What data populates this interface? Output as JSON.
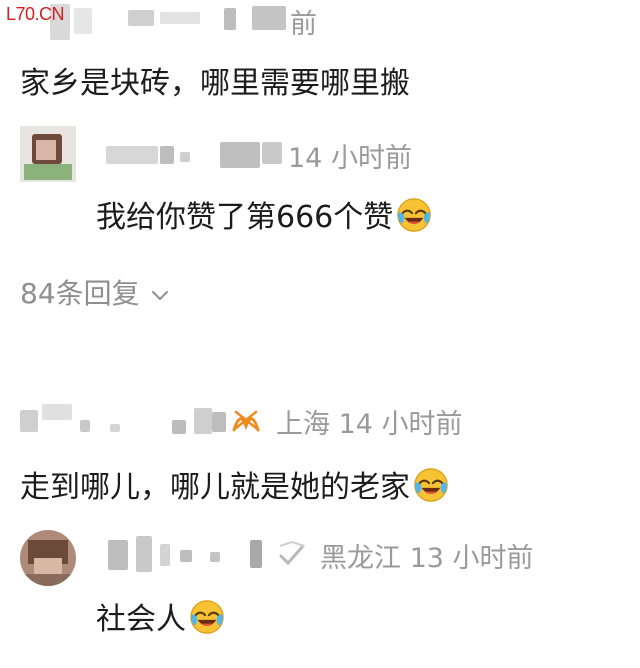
{
  "watermark": "L70.CN",
  "comments": [
    {
      "header_partial_text": "前",
      "content": "家乡是块砖，哪里需要哪里搬"
    },
    {
      "time": "14 小时前",
      "content": "我给你赞了第666个赞",
      "emoji": "laugh-cry"
    },
    {
      "replies_label": "84条回复"
    },
    {
      "location": "上海",
      "time": "14 小时前",
      "content": "走到哪儿，哪儿就是她的老家",
      "emoji": "laugh-cry"
    },
    {
      "location": "黑龙江",
      "time": "13 小时前",
      "content": "社会人",
      "emoji": "laugh-cry"
    }
  ],
  "colors": {
    "text": "#1c1c1c",
    "meta": "#9a9a9a",
    "watermark": "#d42020",
    "emoji_face": "#f7c234"
  }
}
